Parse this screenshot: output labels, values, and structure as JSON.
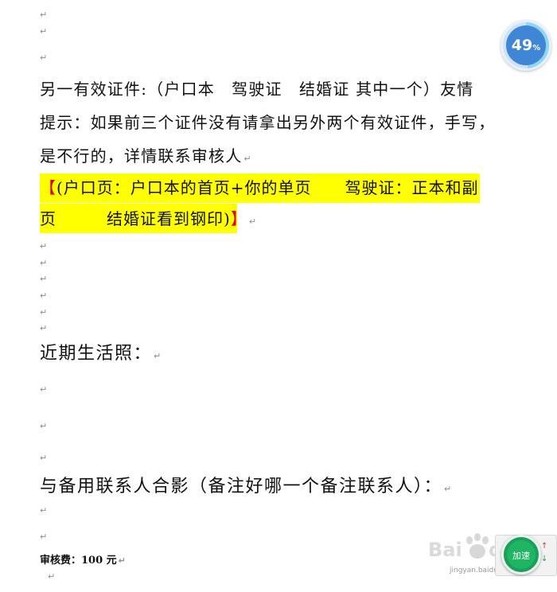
{
  "document": {
    "paragraph_mark": "↵",
    "lines": {
      "id_line1": "另一有效证件:（户口本　驾驶证　结婚证 其中一个）友情",
      "id_line2": "提示：如果前三个证件没有请拿出另外两个有效证件，手写，",
      "id_line3": "是不行的，详情联系审核人",
      "hl_open_bracket": "【",
      "hl_line1": "(户口页：户口本的首页+你的单页　　驾驶证：正本和副",
      "hl_line2": "页　　　结婚证看到钢印)",
      "hl_close_bracket": "】",
      "photo_heading": "近期生活照：",
      "group_photo_heading": "与备用联系人合影（备注好哪一个备注联系人）：",
      "fee": "审核费：100 元"
    }
  },
  "progress_badge": {
    "value": "49",
    "unit": "%",
    "fill_fraction": 0.49
  },
  "floating_widget": {
    "ball_text": "加速",
    "up_arrow": "↑",
    "down_arrow": "↓"
  },
  "watermark": {
    "brand": "Bai du 经验",
    "url": "jingyan.baidu.com"
  },
  "colors": {
    "highlight": "#ffff00",
    "bracket_red": "#e00000",
    "badge_blue": "#3f86d6",
    "widget_green": "#1aa05a"
  }
}
